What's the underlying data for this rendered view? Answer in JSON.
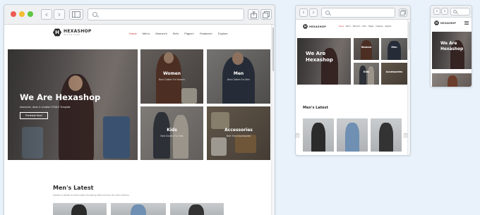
{
  "brand": {
    "name": "HEXASHOP",
    "tagline": "ONLINE SHOP",
    "mark": "H"
  },
  "nav": {
    "items": [
      "Home",
      "Men's",
      "Women's",
      "Kid's",
      "Pages",
      "Features",
      "Explore"
    ],
    "compact_items": [
      "Home",
      "Men's",
      "Women's",
      "Kid's",
      "Pages",
      "Features",
      "Explore"
    ]
  },
  "hero": {
    "title": "We Are Hexashop",
    "title_line1": "We Are",
    "title_line2": "Hexashop",
    "subtitle": "Awesome, clean & creative HTML5 Template",
    "button": "Purchase Now!"
  },
  "tiles": [
    {
      "title": "Women",
      "subtitle": "Best Clothes For Women"
    },
    {
      "title": "Men",
      "subtitle": "Best Clothes For Men"
    },
    {
      "title": "Kids",
      "subtitle": "Best Clothes For Kids"
    },
    {
      "title": "Accessories",
      "subtitle": "Best Trend Accessories"
    }
  ],
  "section": {
    "title": "Men's Latest",
    "subtitle": "Details to details is what makes Hexashop different from the other themes."
  },
  "colors": {
    "page_bg": "#e9f2fa",
    "chrome": "#eef0f2",
    "traffic_red": "#ee5a52",
    "traffic_yellow": "#f5bd2f",
    "traffic_green": "#5fc73f",
    "nav_active": "#c33333"
  },
  "icons": {
    "back": "chevron-left-icon",
    "forward": "chevron-right-icon",
    "sidebar": "sidebar-icon",
    "search": "search-icon",
    "share": "share-icon",
    "tabs": "tabs-icon",
    "menu": "hamburger-menu-icon"
  }
}
